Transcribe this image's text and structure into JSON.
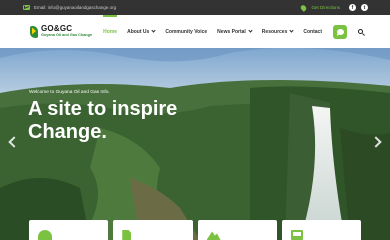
{
  "topbar": {
    "email": "Email: info@guyanaoilandgaschange.org",
    "location": "Get Directions",
    "social": [
      "f",
      "t"
    ]
  },
  "brand": {
    "name": "GO&GC",
    "subtitle": "Guyana Oil and Gas Change"
  },
  "nav": {
    "items": [
      {
        "label": "Home",
        "active": true,
        "dropdown": false
      },
      {
        "label": "About Us",
        "active": false,
        "dropdown": true
      },
      {
        "label": "Community Voice",
        "active": false,
        "dropdown": false
      },
      {
        "label": "News Portal",
        "active": false,
        "dropdown": true
      },
      {
        "label": "Resources",
        "active": false,
        "dropdown": true
      },
      {
        "label": "Contact",
        "active": false,
        "dropdown": false
      }
    ]
  },
  "icons": {
    "chat": "chat-bubble-icon",
    "search": "search-icon",
    "email": "mail-icon",
    "location": "map-pin-icon"
  },
  "hero": {
    "eyebrow": "Welcome to Guyana Oil and Gas Info.",
    "headline": "A site to inspire Change."
  },
  "feature_cards": [
    "card-icon-1",
    "card-icon-2",
    "card-icon-3",
    "card-icon-4"
  ],
  "colors": {
    "accent": "#7cc242",
    "topbar_bg": "#333333",
    "nav_bg": "#ffffff"
  }
}
